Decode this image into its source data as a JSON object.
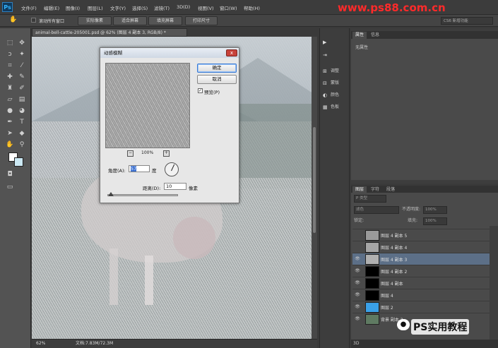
{
  "app": {
    "logo": "Ps",
    "watermark": "www.ps88.com.cn"
  },
  "menu": [
    "文件(F)",
    "编辑(E)",
    "图像(I)",
    "图层(L)",
    "文字(Y)",
    "选择(S)",
    "滤镜(T)",
    "3D(D)",
    "视图(V)",
    "窗口(W)",
    "帮助(H)"
  ],
  "options": {
    "scroll_all": "滚动所有窗口",
    "actual_pixels": "实际像素",
    "fit_screen": "适合屏幕",
    "fill_screen": "填充屏幕",
    "print_size": "打印尺寸",
    "workspace": "CS6 新增功能"
  },
  "document": {
    "tab_title": "animal-bell-cattle-205001.psd @ 62% (图层 4 副本 3, RGB/8) *",
    "zoom": "62%",
    "doc_size": "文档:7.83M/72.3M"
  },
  "dialog": {
    "title": "动感模糊",
    "ok": "确定",
    "cancel": "取消",
    "preview_label": "预览(P)",
    "preview_checked": "✓",
    "preview_zoom": "100%",
    "zoom_out": "−",
    "zoom_in": "+",
    "angle_label": "角度(A):",
    "angle_value": "57",
    "angle_unit": "度",
    "distance_label": "距离(D):",
    "distance_value": "10",
    "distance_unit": "像素",
    "close": "x"
  },
  "mid_panel": [
    {
      "icon": "▶",
      "label": ""
    },
    {
      "icon": "⇥",
      "label": ""
    },
    {
      "icon": "⊞",
      "label": "调整"
    },
    {
      "icon": "⊟",
      "label": "蒙版"
    },
    {
      "icon": "◐",
      "label": "颜色"
    },
    {
      "icon": "▦",
      "label": "色板"
    }
  ],
  "properties": {
    "tab_active": "属性",
    "tab_other": "信息",
    "empty": "无属性"
  },
  "layers_panel": {
    "tabs": [
      "图层",
      "字符",
      "段落"
    ],
    "kind_filter": "P 类型",
    "blend_mode": "滤色",
    "opacity_label": "不透明度:",
    "opacity_value": "100%",
    "lock_label": "锁定:",
    "fill_label": "填充:",
    "fill_value": "100%",
    "layers": [
      {
        "name": "图层 4 副本 5",
        "visible": "",
        "thumb": "#9a9a9a",
        "selected": false
      },
      {
        "name": "图层 4 副本 4",
        "visible": "",
        "thumb": "#a5a5a5",
        "selected": false
      },
      {
        "name": "图层 4 副本 3",
        "visible": "👁",
        "thumb": "#b0b0b0",
        "selected": true
      },
      {
        "name": "图层 4 副本 2",
        "visible": "👁",
        "thumb": "#000000",
        "selected": false
      },
      {
        "name": "图层 4 副本",
        "visible": "👁",
        "thumb": "#000000",
        "selected": false
      },
      {
        "name": "图层 4",
        "visible": "👁",
        "thumb": "#000000",
        "selected": false
      },
      {
        "name": "图层 2",
        "visible": "👁",
        "thumb": "#3aa0e8",
        "selected": false
      },
      {
        "name": "背景 副本 2",
        "visible": "👁",
        "thumb": "#5f7a62",
        "selected": false
      }
    ],
    "bottom_tab": "3D"
  },
  "watermark2": "PS实用教程",
  "colors": {
    "accent": "#5c6f87",
    "ok_border": "#3a7bd5",
    "watermark": "#ff2a2a"
  }
}
